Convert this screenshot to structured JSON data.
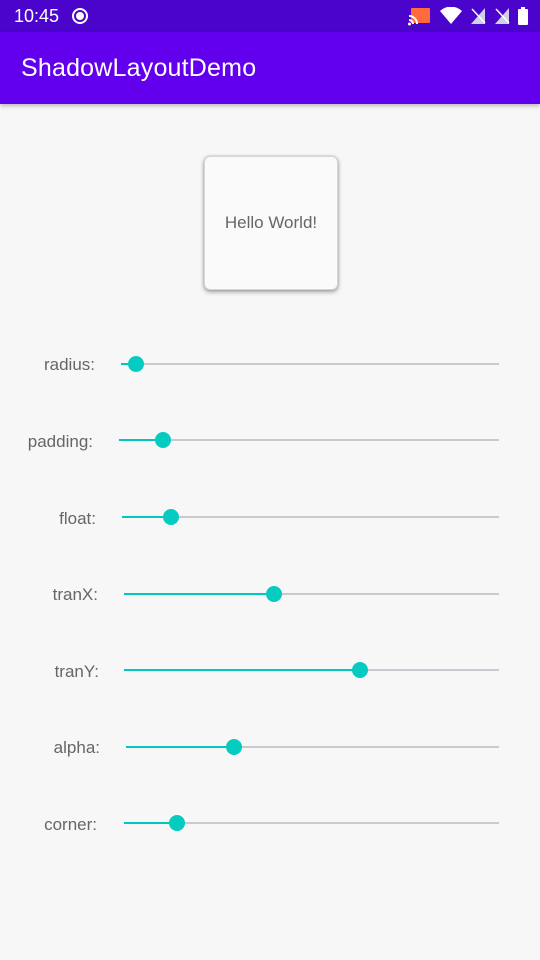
{
  "status_bar": {
    "time": "10:45",
    "icons": [
      "record-icon",
      "cast-icon",
      "wifi-icon",
      "no-sim-icon",
      "no-sim-icon",
      "battery-icon"
    ]
  },
  "app_bar": {
    "title": "ShadowLayoutDemo"
  },
  "card": {
    "text": "Hello World!"
  },
  "sliders": [
    {
      "label": "radius:",
      "value": 0.04
    },
    {
      "label": "padding:",
      "value": 0.115
    },
    {
      "label": "float:",
      "value": 0.13
    },
    {
      "label": "tranX:",
      "value": 0.4
    },
    {
      "label": "tranY:",
      "value": 0.63
    },
    {
      "label": "alpha:",
      "value": 0.29
    },
    {
      "label": "corner:",
      "value": 0.14
    }
  ],
  "colors": {
    "status_bar": "#4a04cc",
    "app_bar": "#6200ee",
    "accent": "#06cbc1",
    "track": "#c9c9d1",
    "background": "#f7f7f7"
  }
}
